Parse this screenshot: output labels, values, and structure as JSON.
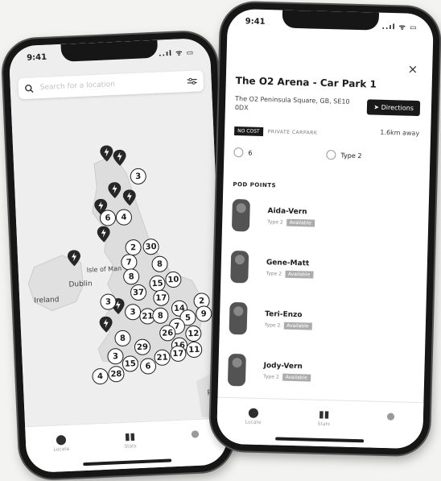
{
  "status": {
    "time": "9:41",
    "signal": "..ıl ᯤ ▭"
  },
  "left": {
    "search": {
      "placeholder": "Search for a location"
    },
    "map_labels": {
      "ireland": "Ireland",
      "dublin": "Dublin",
      "isle_of_man": "Isle of Man",
      "paris": "Paris"
    },
    "clusters": [
      "3",
      "6",
      "4",
      "2",
      "30",
      "7",
      "8",
      "8",
      "15",
      "10",
      "37",
      "17",
      "3",
      "3",
      "21",
      "8",
      "14",
      "5",
      "2",
      "9",
      "7",
      "26",
      "12",
      "8",
      "29",
      "16",
      "3",
      "15",
      "6",
      "21",
      "17",
      "11",
      "4",
      "28"
    ],
    "tabs": [
      {
        "label": "Locate",
        "icon": "location-pin-icon"
      },
      {
        "label": "Stats",
        "icon": "bar-chart-icon"
      },
      {
        "label": "",
        "icon": "user-icon"
      }
    ]
  },
  "right": {
    "close": "×",
    "title": "The O2 Arena - Car Park 1",
    "address": "The O2 Peninsula Square, GB, SE10 0DX",
    "directions": "Directions",
    "tag_primary": "NO COST",
    "tag_secondary": "PRIVATE CARPARK",
    "distance": "1.6km away",
    "stat_count": "6",
    "stat_type": "Type 2",
    "section": "POD POINTS",
    "pods": [
      {
        "name": "Aida-Vern",
        "type": "Type 2",
        "status": "Available"
      },
      {
        "name": "Gene-Matt",
        "type": "Type 2",
        "status": "Available"
      },
      {
        "name": "Teri-Enzo",
        "type": "Type 2",
        "status": "Available"
      },
      {
        "name": "Jody-Vern",
        "type": "Type 2",
        "status": "Available"
      }
    ],
    "tabs": [
      {
        "label": "Locate",
        "icon": "location-pin-icon"
      },
      {
        "label": "Stats",
        "icon": "bar-chart-icon"
      },
      {
        "label": "",
        "icon": "user-icon"
      }
    ]
  }
}
